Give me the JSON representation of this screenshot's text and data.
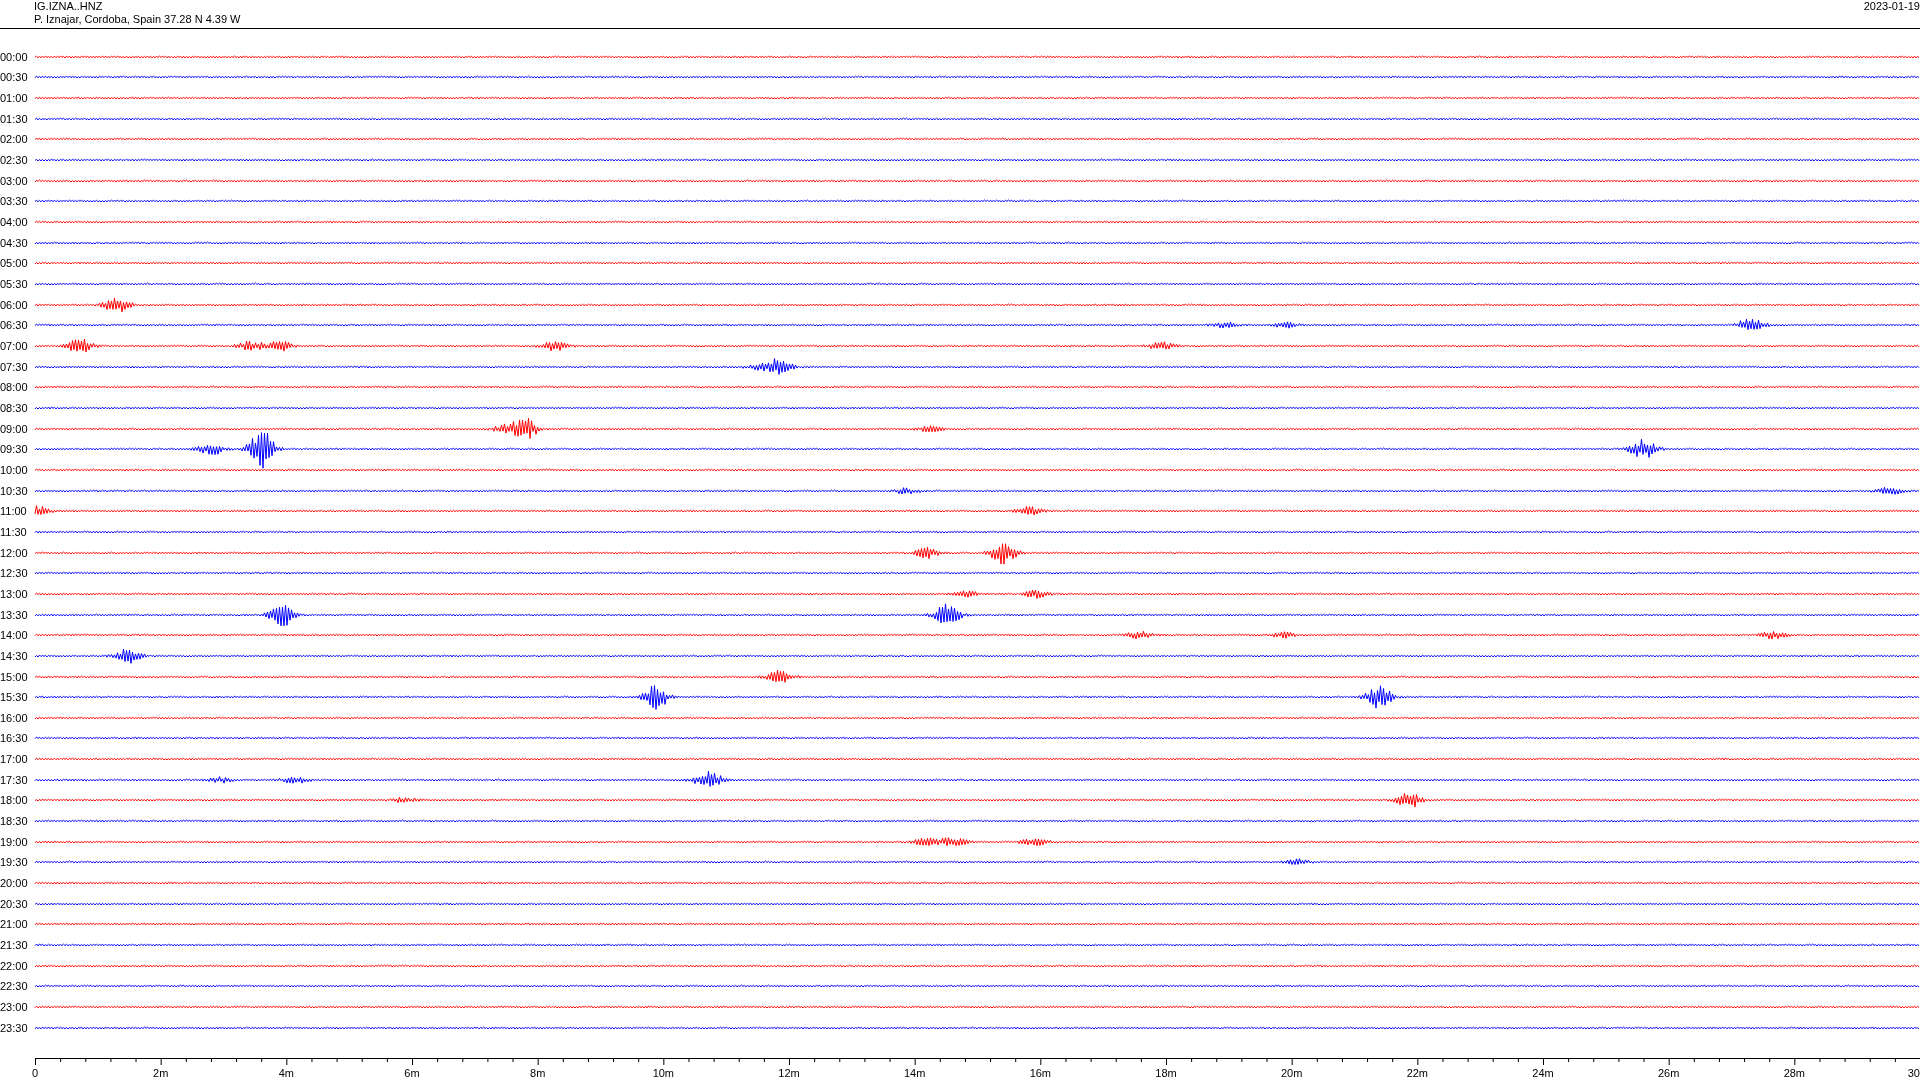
{
  "header": {
    "station": "IG.IZNA..HNZ",
    "location": "P. Iznajar, Cordoba, Spain  37.28 N 4.39 W",
    "date": "2023-01-19"
  },
  "rows": [
    {
      "time": "00:00",
      "color": "#ff0000"
    },
    {
      "time": "00:30",
      "color": "#0000ff"
    },
    {
      "time": "01:00",
      "color": "#ff0000"
    },
    {
      "time": "01:30",
      "color": "#0000ff"
    },
    {
      "time": "02:00",
      "color": "#ff0000"
    },
    {
      "time": "02:30",
      "color": "#0000ff"
    },
    {
      "time": "03:00",
      "color": "#ff0000"
    },
    {
      "time": "03:30",
      "color": "#0000ff"
    },
    {
      "time": "04:00",
      "color": "#ff0000"
    },
    {
      "time": "04:30",
      "color": "#0000ff"
    },
    {
      "time": "05:00",
      "color": "#ff0000"
    },
    {
      "time": "05:30",
      "color": "#0000ff"
    },
    {
      "time": "06:00",
      "color": "#ff0000"
    },
    {
      "time": "06:30",
      "color": "#0000ff"
    },
    {
      "time": "07:00",
      "color": "#ff0000"
    },
    {
      "time": "07:30",
      "color": "#0000ff"
    },
    {
      "time": "08:00",
      "color": "#ff0000"
    },
    {
      "time": "08:30",
      "color": "#0000ff"
    },
    {
      "time": "09:00",
      "color": "#ff0000"
    },
    {
      "time": "09:30",
      "color": "#0000ff"
    },
    {
      "time": "10:00",
      "color": "#ff0000"
    },
    {
      "time": "10:30",
      "color": "#0000ff"
    },
    {
      "time": "11:00",
      "color": "#ff0000"
    },
    {
      "time": "11:30",
      "color": "#0000ff"
    },
    {
      "time": "12:00",
      "color": "#ff0000"
    },
    {
      "time": "12:30",
      "color": "#0000ff"
    },
    {
      "time": "13:00",
      "color": "#ff0000"
    },
    {
      "time": "13:30",
      "color": "#0000ff"
    },
    {
      "time": "14:00",
      "color": "#ff0000"
    },
    {
      "time": "14:30",
      "color": "#0000ff"
    },
    {
      "time": "15:00",
      "color": "#ff0000"
    },
    {
      "time": "15:30",
      "color": "#0000ff"
    },
    {
      "time": "16:00",
      "color": "#ff0000"
    },
    {
      "time": "16:30",
      "color": "#0000ff"
    },
    {
      "time": "17:00",
      "color": "#ff0000"
    },
    {
      "time": "17:30",
      "color": "#0000ff"
    },
    {
      "time": "18:00",
      "color": "#ff0000"
    },
    {
      "time": "18:30",
      "color": "#0000ff"
    },
    {
      "time": "19:00",
      "color": "#ff0000"
    },
    {
      "time": "19:30",
      "color": "#0000ff"
    },
    {
      "time": "20:00",
      "color": "#ff0000"
    },
    {
      "time": "20:30",
      "color": "#0000ff"
    },
    {
      "time": "21:00",
      "color": "#ff0000"
    },
    {
      "time": "21:30",
      "color": "#0000ff"
    },
    {
      "time": "22:00",
      "color": "#ff0000"
    },
    {
      "time": "22:30",
      "color": "#0000ff"
    },
    {
      "time": "23:00",
      "color": "#ff0000"
    },
    {
      "time": "23:30",
      "color": "#0000ff"
    }
  ],
  "axis_labels": [
    "0",
    "2m",
    "4m",
    "6m",
    "8m",
    "10m",
    "12m",
    "14m",
    "16m",
    "18m",
    "20m",
    "22m",
    "24m",
    "26m",
    "28m",
    "30"
  ]
}
